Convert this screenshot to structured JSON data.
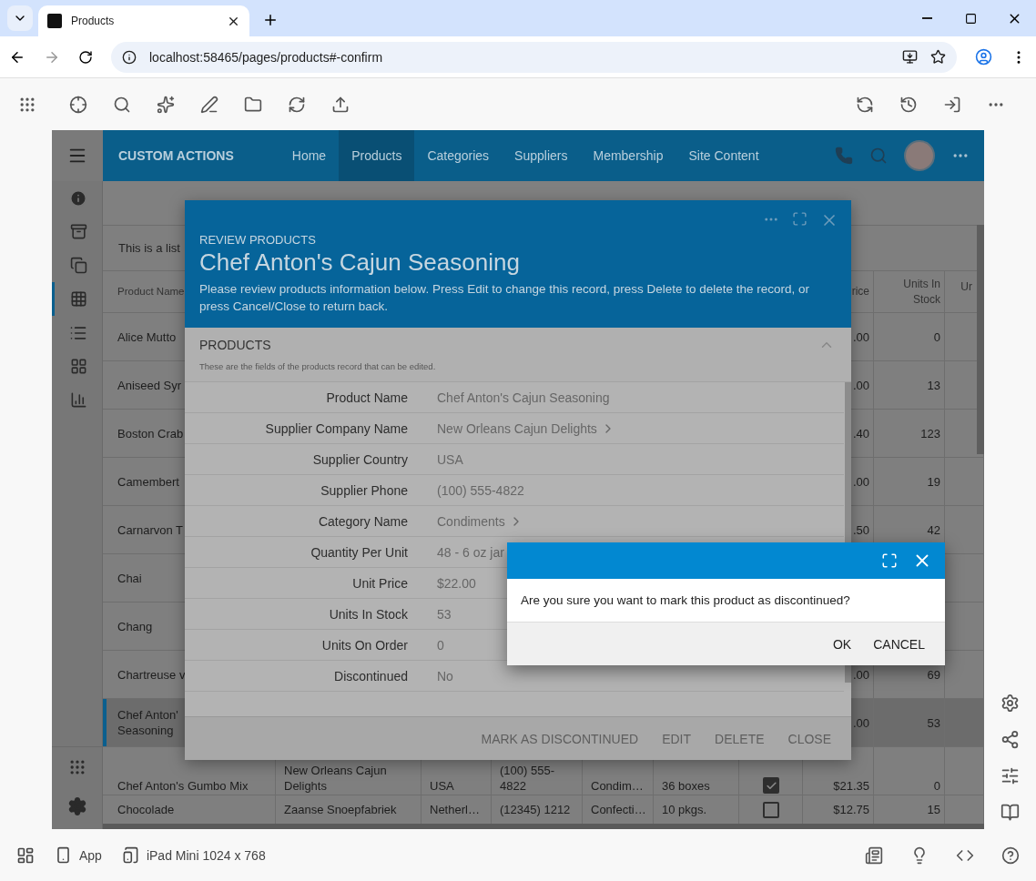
{
  "browser": {
    "tab_title": "Products",
    "url": "localhost:58465/pages/products#-confirm"
  },
  "app": {
    "brand": "CUSTOM ACTIONS",
    "nav": [
      {
        "label": "Home",
        "selected": false
      },
      {
        "label": "Products",
        "selected": true
      },
      {
        "label": "Categories",
        "selected": false
      },
      {
        "label": "Suppliers",
        "selected": false
      },
      {
        "label": "Membership",
        "selected": false
      },
      {
        "label": "Site Content",
        "selected": false
      }
    ]
  },
  "sidebar": {
    "items": [
      {
        "kind": "info",
        "selected": false
      },
      {
        "kind": "archive",
        "selected": false
      },
      {
        "kind": "pages",
        "selected": false
      },
      {
        "kind": "grid",
        "selected": true
      },
      {
        "kind": "list",
        "selected": false
      },
      {
        "kind": "tiles",
        "selected": false
      },
      {
        "kind": "chart",
        "selected": false
      }
    ]
  },
  "list": {
    "description": "This is a list",
    "header": {
      "name": "Product Name",
      "price": "rice",
      "stock": "Units In Stock",
      "column_10": "Ur"
    },
    "rows": [
      {
        "selected": false,
        "name": "Alice Mutto",
        "price": ".00",
        "stock": "0"
      },
      {
        "selected": false,
        "name": "Aniseed Syr",
        "price": ".00",
        "stock": "13"
      },
      {
        "selected": false,
        "name": "Boston Crab",
        "price": ".40",
        "stock": "123"
      },
      {
        "selected": false,
        "name": "Camembert",
        "price": ".00",
        "stock": "19"
      },
      {
        "selected": false,
        "name": "Carnarvon T",
        "price": ".50",
        "stock": "42"
      },
      {
        "selected": false,
        "name": "Chai"
      },
      {
        "selected": false,
        "name": "Chang"
      },
      {
        "selected": false,
        "name": "Chartreuse v",
        "price": ".00",
        "stock": "69"
      },
      {
        "selected": true,
        "name": "Chef Anton' Seasoning",
        "price": ".00",
        "stock": "53"
      },
      {
        "selected": false,
        "name": "Chef Anton's Gumbo Mix",
        "supplier": "New Orleans Cajun Delights",
        "country": "USA",
        "phone": "(100) 555-4822",
        "category": "Condim…",
        "quantity": "36 boxes",
        "discontinued": true,
        "price": "$21.35",
        "stock": "0"
      },
      {
        "selected": false,
        "name": "Chocolade",
        "supplier": "Zaanse Snoepfabriek",
        "country": "Netherl…",
        "phone": "(12345) 1212",
        "category": "Confecti…",
        "quantity": "10 pkgs.",
        "discontinued": false,
        "price": "$12.75",
        "stock": "15"
      }
    ]
  },
  "review": {
    "eyebrow": "REVIEW PRODUCTS",
    "title": "Chef Anton's Cajun Seasoning",
    "instructions": "Please review products information below. Press Edit to change this record, press Delete to delete the record, or press Cancel/Close to return back.",
    "section": {
      "title": "PRODUCTS",
      "subtitle": "These are the fields of the products record that can be edited.",
      "expanded": true
    },
    "fields": [
      {
        "label": "Product Name",
        "value": "Chef Anton's Cajun Seasoning",
        "link": false
      },
      {
        "label": "Supplier Company Name",
        "value": "New Orleans Cajun Delights",
        "link": true
      },
      {
        "label": "Supplier Country",
        "value": "USA",
        "link": false
      },
      {
        "label": "Supplier Phone",
        "value": "(100) 555-4822",
        "link": false
      },
      {
        "label": "Category Name",
        "value": "Condiments",
        "link": true
      },
      {
        "label": "Quantity Per Unit",
        "value": "48 - 6 oz jar",
        "link": false
      },
      {
        "label": "Unit Price",
        "value": "$22.00",
        "link": false
      },
      {
        "label": "Units In Stock",
        "value": "53",
        "link": false
      },
      {
        "label": "Units On Order",
        "value": "0",
        "link": false
      },
      {
        "label": "Discontinued",
        "value": "No",
        "link": false
      }
    ],
    "actions": [
      "MARK AS DISCONTINUED",
      "EDIT",
      "DELETE",
      "CLOSE"
    ]
  },
  "confirm": {
    "message": "Are you sure you want to mark this product as discontinued?",
    "buttons": [
      "OK",
      "CANCEL"
    ]
  },
  "status_bar": {
    "mode": "App",
    "device": "iPad Mini 1024 x 768"
  }
}
